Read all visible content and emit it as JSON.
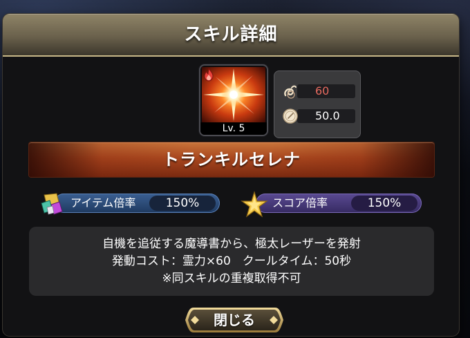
{
  "dialog": {
    "title": "スキル詳細"
  },
  "skill": {
    "icon": "radiant-starburst",
    "element_icon": "fire-icon",
    "level_label": "Lv. 5",
    "name": "トランキルセレナ"
  },
  "stats": {
    "cost": {
      "icon": "spirit-power-icon",
      "value": "60",
      "color": "#e66a5f"
    },
    "cooldown": {
      "icon": "clock-icon",
      "value": "50.0",
      "color": "#ffffff"
    }
  },
  "multipliers": {
    "item": {
      "icon": "item-gems-icon",
      "label": "アイテム倍率",
      "value": "150%",
      "color": "#2c4d7a"
    },
    "score": {
      "icon": "gold-star-icon",
      "label": "スコア倍率",
      "value": "150%",
      "color": "#4a3a78"
    }
  },
  "description": {
    "lines": [
      "自機を追従する魔導書から、極太レーザーを発射",
      "発動コスト：霊力×60　クールタイム：50秒",
      "※同スキルの重複取得不可"
    ]
  },
  "buttons": {
    "close_label": "閉じる"
  },
  "colors": {
    "title_bar": "#6a614c",
    "banner": "#a9471e",
    "accent_gold": "#c9b98a"
  }
}
